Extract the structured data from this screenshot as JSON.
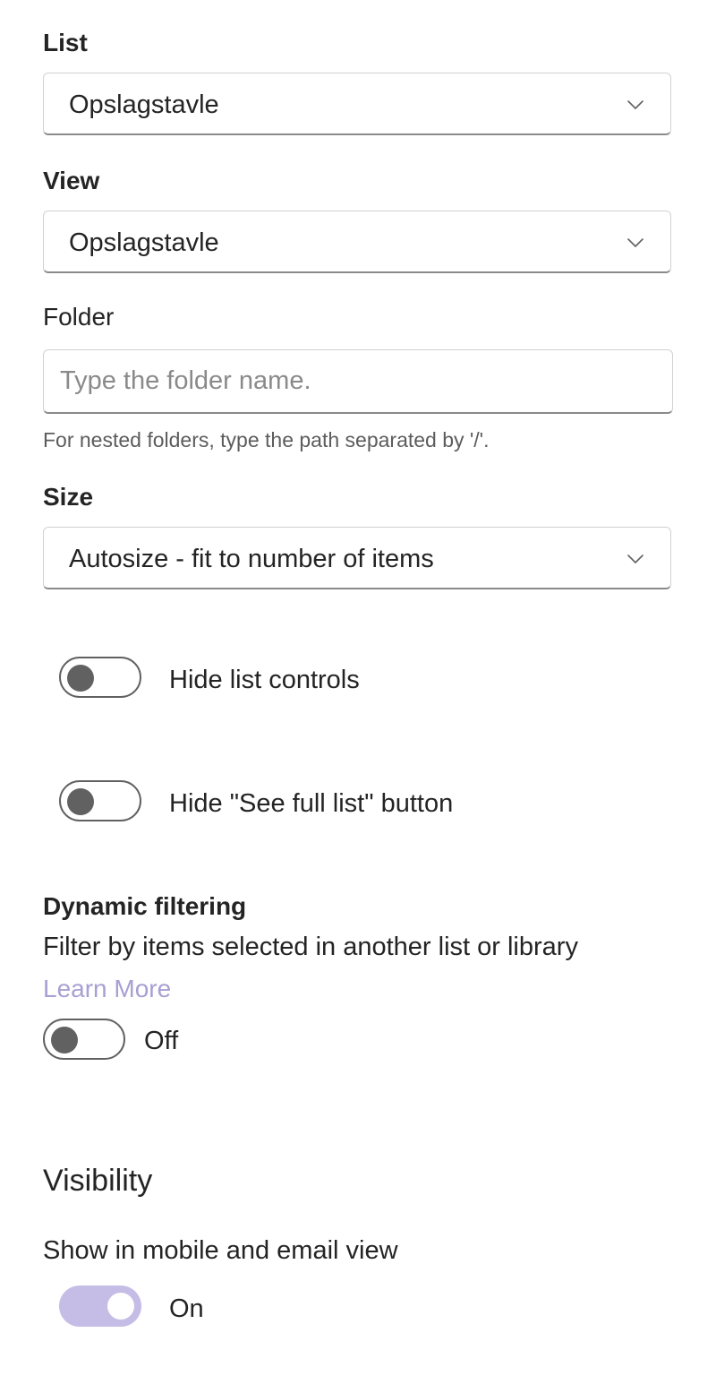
{
  "list": {
    "label": "List",
    "selected": "Opslagstavle"
  },
  "view": {
    "label": "View",
    "selected": "Opslagstavle"
  },
  "folder": {
    "label": "Folder",
    "placeholder": "Type the folder name.",
    "value": "",
    "hint": "For nested folders, type the path separated by '/'."
  },
  "size": {
    "label": "Size",
    "selected": "Autosize - fit to number of items"
  },
  "hide_list_controls": {
    "label": "Hide list controls",
    "checked": false
  },
  "hide_see_full_list": {
    "label": "Hide \"See full list\" button",
    "checked": false
  },
  "dynamic_filtering": {
    "heading": "Dynamic filtering",
    "description": "Filter by items selected in another list or library",
    "link": "Learn More",
    "toggle_state": "Off",
    "checked": false
  },
  "visibility": {
    "heading": "Visibility",
    "show_label": "Show in mobile and email view",
    "toggle_state": "On",
    "checked": true
  },
  "icons": {
    "dropdown_chevron": "chevron-down-icon"
  },
  "colors": {
    "link": "#a89fd3",
    "toggle_on_track": "#c5bde6",
    "toggle_off_knob": "#616161"
  }
}
